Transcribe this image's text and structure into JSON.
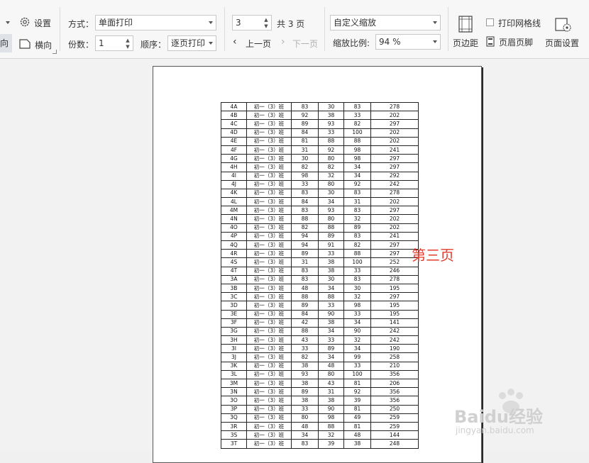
{
  "toolbar": {
    "orientation_partial": "向",
    "settings_label": "设置",
    "landscape_label": "横向",
    "mode_label": "方式：",
    "mode_value": "单面打印",
    "copies_label": "份数：",
    "copies_value": "1",
    "order_label": "顺序：",
    "order_value": "逐页打印",
    "page_value": "3",
    "page_total": "共 3 页",
    "prev_label": "上一页",
    "next_label": "下一页",
    "zoom_mode_value": "自定义缩放",
    "zoom_ratio_label": "缩放比例:",
    "zoom_ratio_value": "94 %",
    "margins_label": "页边距",
    "gridlines_label": "打印网格线",
    "header_footer_label": "页眉页脚",
    "page_setup_label": "页面设置"
  },
  "annotation": "第三页",
  "watermark": {
    "brand": "Baidu经验",
    "url": "jingyan.baidu.com"
  },
  "table_rows": [
    [
      "4A",
      "初一（3）班",
      "83",
      "30",
      "83",
      "278"
    ],
    [
      "4B",
      "初一（3）班",
      "92",
      "38",
      "33",
      "202"
    ],
    [
      "4C",
      "初一（3）班",
      "89",
      "93",
      "82",
      "297"
    ],
    [
      "4D",
      "初一（3）班",
      "84",
      "33",
      "100",
      "202"
    ],
    [
      "4E",
      "初一（3）班",
      "81",
      "88",
      "88",
      "202"
    ],
    [
      "4F",
      "初一（3）班",
      "31",
      "92",
      "98",
      "241"
    ],
    [
      "4G",
      "初一（3）班",
      "30",
      "80",
      "98",
      "297"
    ],
    [
      "4H",
      "初一（3）班",
      "82",
      "82",
      "34",
      "297"
    ],
    [
      "4I",
      "初一（3）班",
      "98",
      "32",
      "34",
      "292"
    ],
    [
      "4J",
      "初一（3）班",
      "33",
      "80",
      "92",
      "242"
    ],
    [
      "4K",
      "初一（3）班",
      "83",
      "30",
      "83",
      "278"
    ],
    [
      "4L",
      "初一（3）班",
      "84",
      "34",
      "31",
      "202"
    ],
    [
      "4M",
      "初一（3）班",
      "83",
      "93",
      "83",
      "297"
    ],
    [
      "4N",
      "初一（3）班",
      "88",
      "80",
      "32",
      "202"
    ],
    [
      "4O",
      "初一（3）班",
      "82",
      "88",
      "89",
      "202"
    ],
    [
      "4P",
      "初一（3）班",
      "94",
      "89",
      "83",
      "241"
    ],
    [
      "4Q",
      "初一（3）班",
      "94",
      "91",
      "82",
      "297"
    ],
    [
      "4R",
      "初一（3）班",
      "89",
      "33",
      "88",
      "297"
    ],
    [
      "4S",
      "初一（3）班",
      "31",
      "38",
      "100",
      "252"
    ],
    [
      "4T",
      "初一（3）班",
      "83",
      "38",
      "33",
      "246"
    ],
    [
      "3A",
      "初一（3）班",
      "83",
      "30",
      "83",
      "278"
    ],
    [
      "3B",
      "初一（3）班",
      "48",
      "34",
      "30",
      "195"
    ],
    [
      "3C",
      "初一（3）班",
      "88",
      "88",
      "32",
      "297"
    ],
    [
      "3D",
      "初一（3）班",
      "89",
      "33",
      "98",
      "195"
    ],
    [
      "3E",
      "初一（3）班",
      "84",
      "90",
      "33",
      "195"
    ],
    [
      "3F",
      "初一（3）班",
      "42",
      "38",
      "34",
      "141"
    ],
    [
      "3G",
      "初一（3）班",
      "88",
      "34",
      "90",
      "242"
    ],
    [
      "3H",
      "初一（3）班",
      "43",
      "33",
      "32",
      "242"
    ],
    [
      "3I",
      "初一（3）班",
      "33",
      "89",
      "34",
      "190"
    ],
    [
      "3J",
      "初一（3）班",
      "82",
      "34",
      "99",
      "258"
    ],
    [
      "3K",
      "初一（3）班",
      "38",
      "48",
      "33",
      "210"
    ],
    [
      "3L",
      "初一（3）班",
      "93",
      "80",
      "100",
      "356"
    ],
    [
      "3M",
      "初一（3）班",
      "38",
      "43",
      "81",
      "206"
    ],
    [
      "3N",
      "初一（3）班",
      "89",
      "31",
      "92",
      "356"
    ],
    [
      "3O",
      "初一（3）班",
      "38",
      "38",
      "39",
      "356"
    ],
    [
      "3P",
      "初一（3）班",
      "33",
      "90",
      "81",
      "250"
    ],
    [
      "3Q",
      "初一（3）班",
      "80",
      "98",
      "49",
      "259"
    ],
    [
      "3R",
      "初一（3）班",
      "48",
      "88",
      "81",
      "259"
    ],
    [
      "3S",
      "初一（3）班",
      "34",
      "32",
      "48",
      "144"
    ],
    [
      "3T",
      "初一（3）班",
      "83",
      "39",
      "38",
      "248"
    ]
  ]
}
